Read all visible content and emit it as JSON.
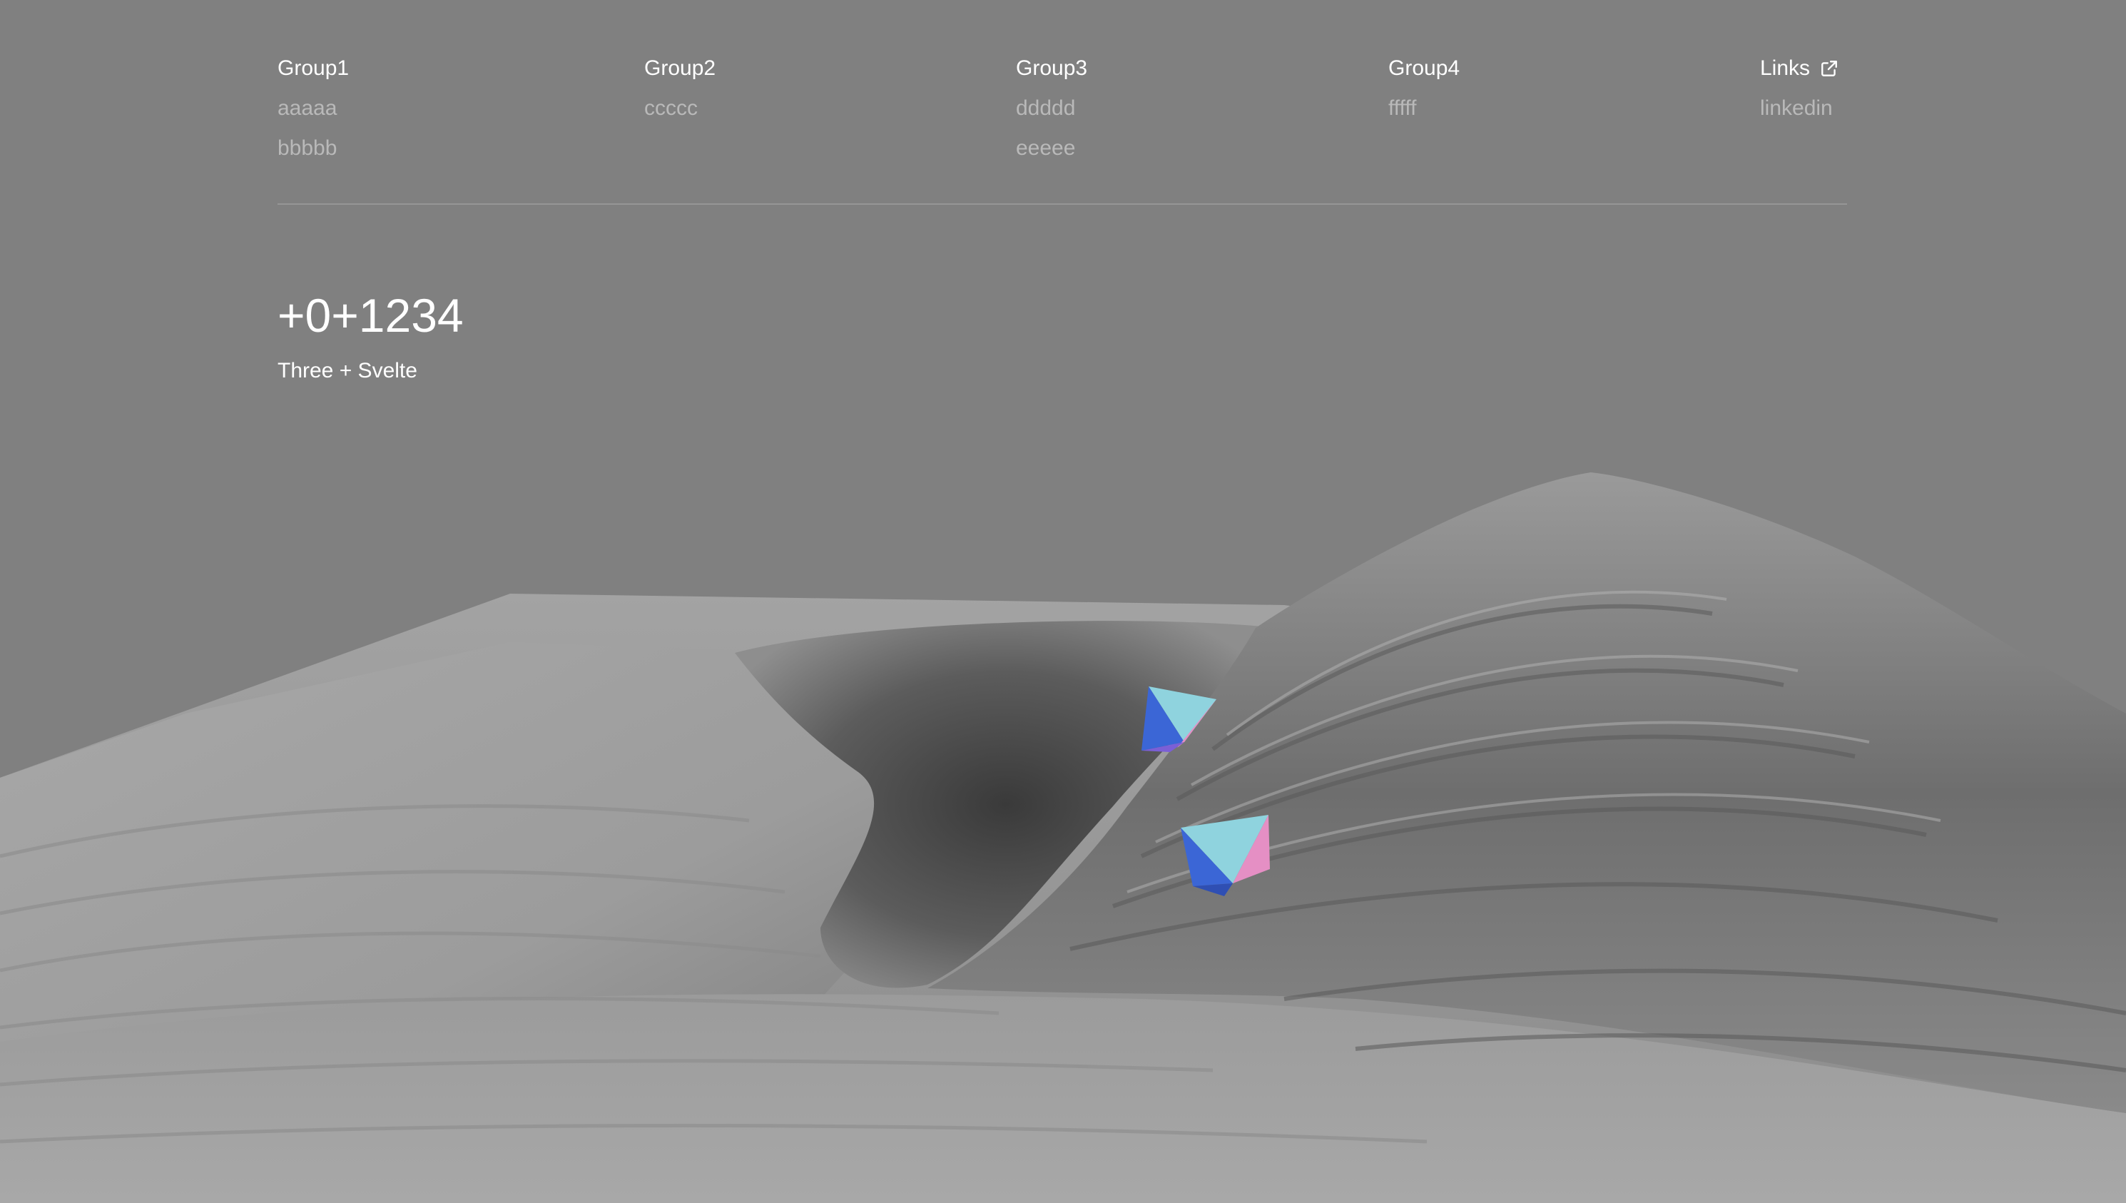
{
  "nav": {
    "groups": [
      {
        "heading": "Group1",
        "links": [
          "aaaaa",
          "bbbbb"
        ]
      },
      {
        "heading": "Group2",
        "links": [
          "ccccc"
        ]
      },
      {
        "heading": "Group3",
        "links": [
          "ddddd",
          "eeeee"
        ]
      },
      {
        "heading": "Group4",
        "links": [
          "fffff"
        ]
      },
      {
        "heading": "Links",
        "icon": "external-link-icon",
        "links": [
          "linkedin"
        ]
      }
    ]
  },
  "hero": {
    "number": "+0+1234",
    "subtitle": "Three + Svelte"
  },
  "scene": {
    "description_icon": "terrain-3d-scene",
    "colors": {
      "background": "#808080",
      "octahedron_cyan": "#8fd3de",
      "octahedron_blue": "#3b66d6",
      "octahedron_pink": "#e58fc4",
      "octahedron_purple": "#7b5fd6"
    }
  }
}
